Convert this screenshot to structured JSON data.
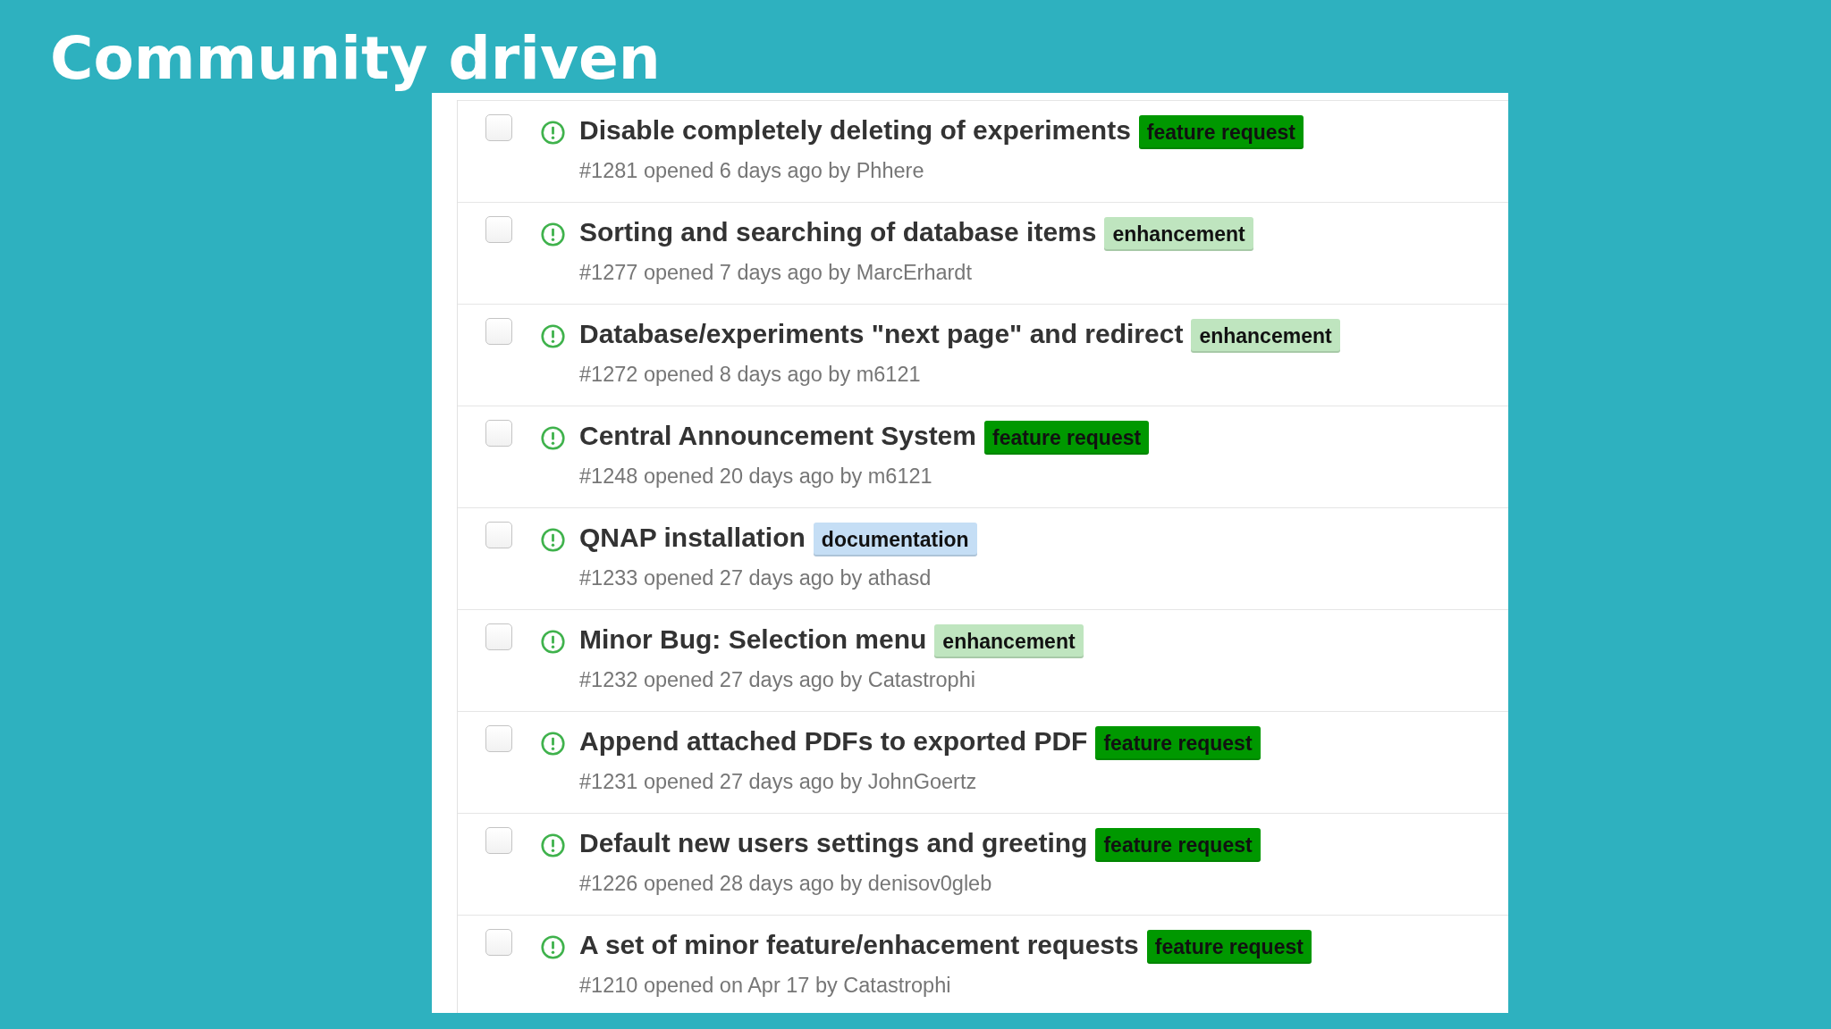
{
  "slide_title": "Community driven",
  "issues": [
    {
      "checked": false,
      "title": "Disable completely deleting of experiments",
      "labels": [
        {
          "text": "feature request",
          "color": "#009800"
        }
      ],
      "meta": "#1281 opened 6 days ago by Phhere"
    },
    {
      "checked": false,
      "title": "Sorting and searching of database items",
      "labels": [
        {
          "text": "enhancement",
          "color": "#bfe5bf"
        }
      ],
      "meta": "#1277 opened 7 days ago by MarcErhardt"
    },
    {
      "checked": false,
      "title": "Database/experiments \"next page\" and redirect",
      "labels": [
        {
          "text": "enhancement",
          "color": "#bfe5bf"
        }
      ],
      "meta": "#1272 opened 8 days ago by m6121"
    },
    {
      "checked": false,
      "title": "Central Announcement System",
      "labels": [
        {
          "text": "feature request",
          "color": "#009800"
        }
      ],
      "meta": "#1248 opened 20 days ago by m6121"
    },
    {
      "checked": false,
      "title": "QNAP installation",
      "labels": [
        {
          "text": "documentation",
          "color": "#c5def5"
        }
      ],
      "meta": "#1233 opened 27 days ago by athasd"
    },
    {
      "checked": false,
      "title": "Minor Bug: Selection menu",
      "labels": [
        {
          "text": "enhancement",
          "color": "#bfe5bf"
        }
      ],
      "meta": "#1232 opened 27 days ago by Catastrophi"
    },
    {
      "checked": false,
      "title": "Append attached PDFs to exported PDF",
      "labels": [
        {
          "text": "feature request",
          "color": "#009800"
        }
      ],
      "meta": "#1231 opened 27 days ago by JohnGoertz"
    },
    {
      "checked": false,
      "title": "Default new users settings and greeting",
      "labels": [
        {
          "text": "feature request",
          "color": "#009800"
        }
      ],
      "meta": "#1226 opened 28 days ago by denisov0gleb"
    },
    {
      "checked": false,
      "title": "A set of minor feature/enhacement requests",
      "labels": [
        {
          "text": "feature request",
          "color": "#009800"
        }
      ],
      "meta": "#1210 opened on Apr 17 by Catastrophi"
    }
  ]
}
